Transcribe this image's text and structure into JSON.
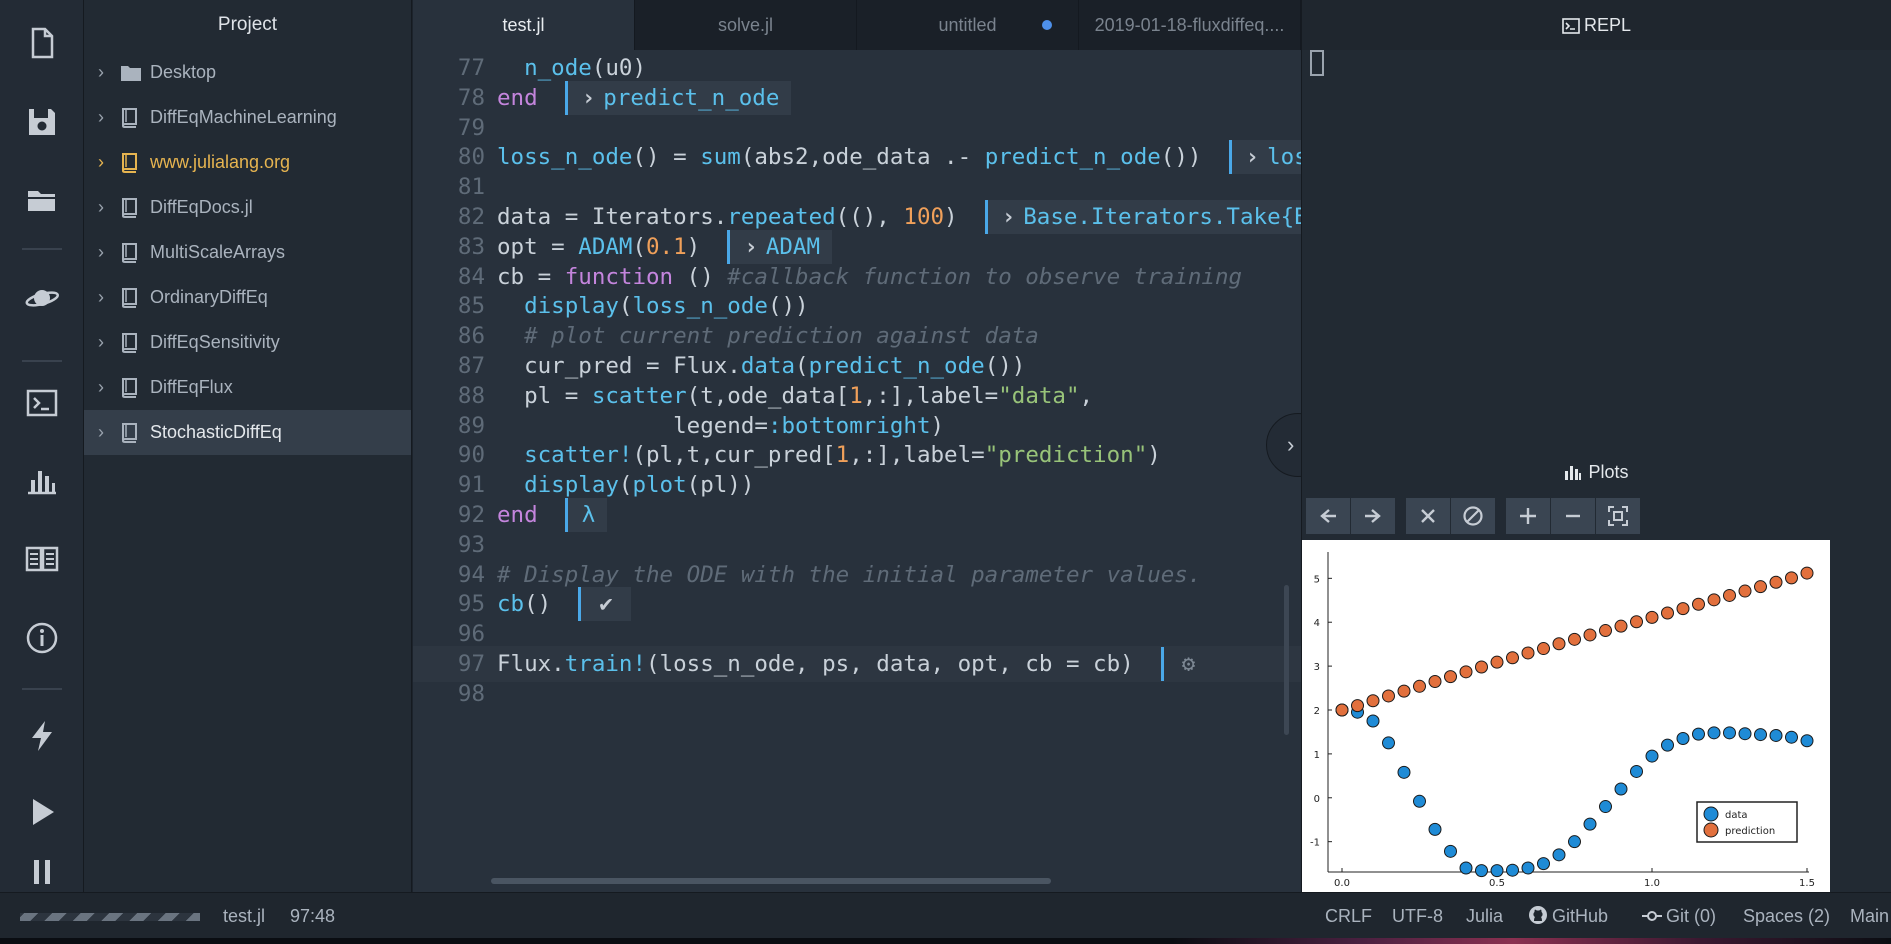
{
  "toolbar": {
    "icons": [
      "new-file-icon",
      "save-icon",
      "open-folder-icon",
      "planet-icon",
      "terminal-icon",
      "plots-icon",
      "docs-icon",
      "info-icon",
      "lightning-icon",
      "run-icon",
      "pause-icon"
    ]
  },
  "project": {
    "title": "Project",
    "items": [
      {
        "label": "Desktop",
        "kind": "folder"
      },
      {
        "label": "DiffEqMachineLearning",
        "kind": "repo"
      },
      {
        "label": "www.julialang.org",
        "kind": "repo"
      },
      {
        "label": "DiffEqDocs.jl",
        "kind": "repo"
      },
      {
        "label": "MultiScaleArrays",
        "kind": "repo"
      },
      {
        "label": "OrdinaryDiffEq",
        "kind": "repo"
      },
      {
        "label": "DiffEqSensitivity",
        "kind": "repo"
      },
      {
        "label": "DiffEqFlux",
        "kind": "repo"
      },
      {
        "label": "StochasticDiffEq",
        "kind": "repo"
      }
    ]
  },
  "tabs": [
    {
      "label": "test.jl",
      "active": true
    },
    {
      "label": "solve.jl",
      "active": false
    },
    {
      "label": "untitled",
      "active": false,
      "modified": true
    },
    {
      "label": "2019-01-18-fluxdiffeq....",
      "active": false
    }
  ],
  "editor": {
    "lines": [
      {
        "n": "77"
      },
      {
        "n": "78"
      },
      {
        "n": "79"
      },
      {
        "n": "80"
      },
      {
        "n": "81"
      },
      {
        "n": "82"
      },
      {
        "n": "83"
      },
      {
        "n": "84"
      },
      {
        "n": "85"
      },
      {
        "n": "86"
      },
      {
        "n": "87"
      },
      {
        "n": "88"
      },
      {
        "n": "89"
      },
      {
        "n": "90"
      },
      {
        "n": "91"
      },
      {
        "n": "92"
      },
      {
        "n": "93"
      },
      {
        "n": "94"
      },
      {
        "n": "95"
      },
      {
        "n": "96"
      },
      {
        "n": "97"
      },
      {
        "n": "98"
      }
    ],
    "results": {
      "r78": "predict_n_ode",
      "r80": "los",
      "r82": "Base.Iterators.Take{B",
      "r83": "ADAM",
      "r92": "λ"
    }
  },
  "repl": {
    "title": "REPL"
  },
  "plots": {
    "title": "Plots",
    "tools": [
      "back-icon",
      "forward-icon",
      "close-icon",
      "clear-all-icon",
      "zoom-in-icon",
      "zoom-out-icon",
      "fit-icon"
    ]
  },
  "chart_data": {
    "type": "scatter",
    "xlim": [
      0.0,
      1.5
    ],
    "ylim": [
      -1.6,
      5.6
    ],
    "xticks": [
      "0.0",
      "0.5",
      "1.0",
      "1.5"
    ],
    "yticks": [
      "-1",
      "0",
      "1",
      "2",
      "3",
      "4",
      "5"
    ],
    "legend": "bottom-right",
    "series": [
      {
        "name": "data",
        "color": "#1f8bd6",
        "x": [
          0.0,
          0.05,
          0.1,
          0.15,
          0.2,
          0.25,
          0.3,
          0.35,
          0.4,
          0.45,
          0.5,
          0.55,
          0.6,
          0.65,
          0.7,
          0.75,
          0.8,
          0.85,
          0.9,
          0.95,
          1.0,
          1.05,
          1.1,
          1.15,
          1.2,
          1.25,
          1.3,
          1.35,
          1.4,
          1.45,
          1.5
        ],
        "y": [
          2.0,
          1.95,
          1.75,
          1.25,
          0.58,
          -0.08,
          -0.72,
          -1.22,
          -1.6,
          -1.66,
          -1.66,
          -1.65,
          -1.6,
          -1.5,
          -1.3,
          -1.0,
          -0.6,
          -0.2,
          0.2,
          0.6,
          0.95,
          1.2,
          1.35,
          1.45,
          1.48,
          1.48,
          1.46,
          1.44,
          1.42,
          1.38,
          1.3
        ]
      },
      {
        "name": "prediction",
        "color": "#e2703d",
        "x": [
          0.0,
          0.05,
          0.1,
          0.15,
          0.2,
          0.25,
          0.3,
          0.35,
          0.4,
          0.45,
          0.5,
          0.55,
          0.6,
          0.65,
          0.7,
          0.75,
          0.8,
          0.85,
          0.9,
          0.95,
          1.0,
          1.05,
          1.1,
          1.15,
          1.2,
          1.25,
          1.3,
          1.35,
          1.4,
          1.45,
          1.5
        ],
        "y": [
          2.0,
          2.1,
          2.21,
          2.32,
          2.43,
          2.54,
          2.65,
          2.76,
          2.87,
          2.98,
          3.09,
          3.19,
          3.3,
          3.4,
          3.51,
          3.61,
          3.71,
          3.81,
          3.91,
          4.01,
          4.11,
          4.21,
          4.31,
          4.41,
          4.51,
          4.61,
          4.71,
          4.81,
          4.91,
          5.01,
          5.12
        ]
      }
    ]
  },
  "status": {
    "file": "test.jl",
    "cursor": "97:48",
    "line_ending": "CRLF",
    "encoding": "UTF-8",
    "grammar": "Julia",
    "github": "GitHub",
    "git": "Git (0)",
    "indent": "Spaces (2)",
    "branch": "Main"
  }
}
